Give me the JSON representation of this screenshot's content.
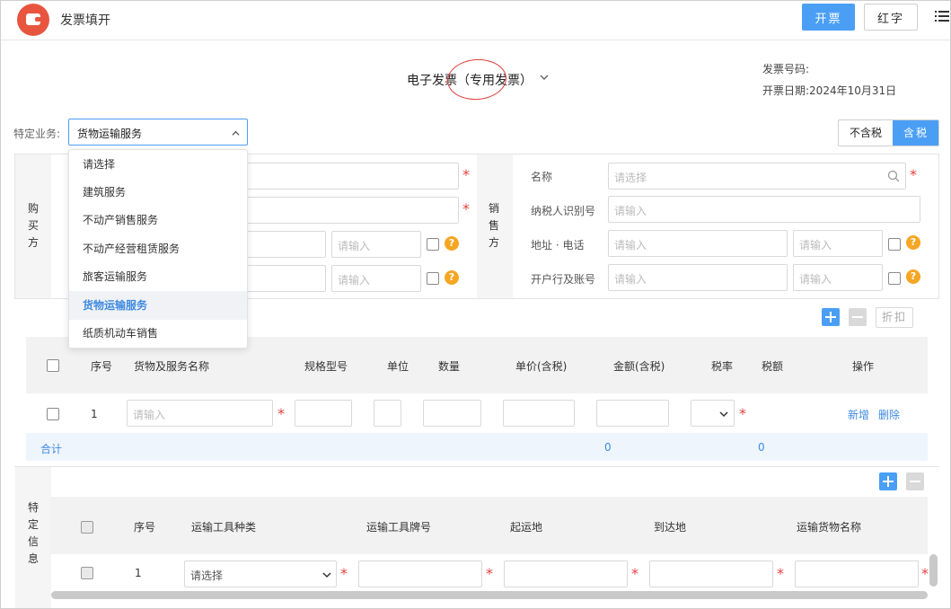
{
  "header": {
    "title": "发票填开",
    "issue_button": "开票",
    "red_button": "红字",
    "menu_icon": "menu-icon",
    "logo_color": "#e8553f"
  },
  "invoice": {
    "type_title": "电子发票（专用发票）",
    "number_label": "发票号码:",
    "date_label": "开票日期:",
    "date_value": "2024年10月31日"
  },
  "special_business": {
    "label": "特定业务:",
    "selected": "货物运输服务",
    "options": [
      "请选择",
      "建筑服务",
      "不动产销售服务",
      "不动产经营租赁服务",
      "旅客运输服务",
      "货物运输服务",
      "纸质机动车销售"
    ]
  },
  "tax_mode": {
    "exclusive": "不含税",
    "inclusive": "含税",
    "active": "含税"
  },
  "buyer": {
    "label": [
      "购",
      "买",
      "方"
    ],
    "placeholder": "请输入"
  },
  "seller": {
    "label": [
      "销",
      "售",
      "方"
    ],
    "name_label": "名称",
    "name_placeholder": "请选择",
    "tax_id_label": "纳税人识别号",
    "address_label": "地址 · 电话",
    "bank_label": "开户行及账号",
    "placeholder": "请输入"
  },
  "goods": {
    "discount_button": "折扣",
    "columns": [
      "序号",
      "货物及服务名称",
      "规格型号",
      "单位",
      "数量",
      "单价(含税)",
      "金额(含税)",
      "税率",
      "税额",
      "操作"
    ],
    "rows": [
      {
        "index": "1",
        "name_placeholder": "请输入",
        "actions": [
          "新增",
          "删除"
        ]
      }
    ],
    "total_label": "合计",
    "total_amount": "0",
    "total_tax": "0"
  },
  "special_info": {
    "label": [
      "特",
      "定",
      "信",
      "息"
    ],
    "columns": [
      "序号",
      "运输工具种类",
      "运输工具牌号",
      "起运地",
      "到达地",
      "运输货物名称"
    ],
    "rows": [
      {
        "index": "1",
        "vehicle_type": "请选择"
      }
    ]
  },
  "colors": {
    "primary": "#4a9ff5",
    "link": "#3f8ae0",
    "required": "#e84040",
    "help": "#f5a623"
  }
}
